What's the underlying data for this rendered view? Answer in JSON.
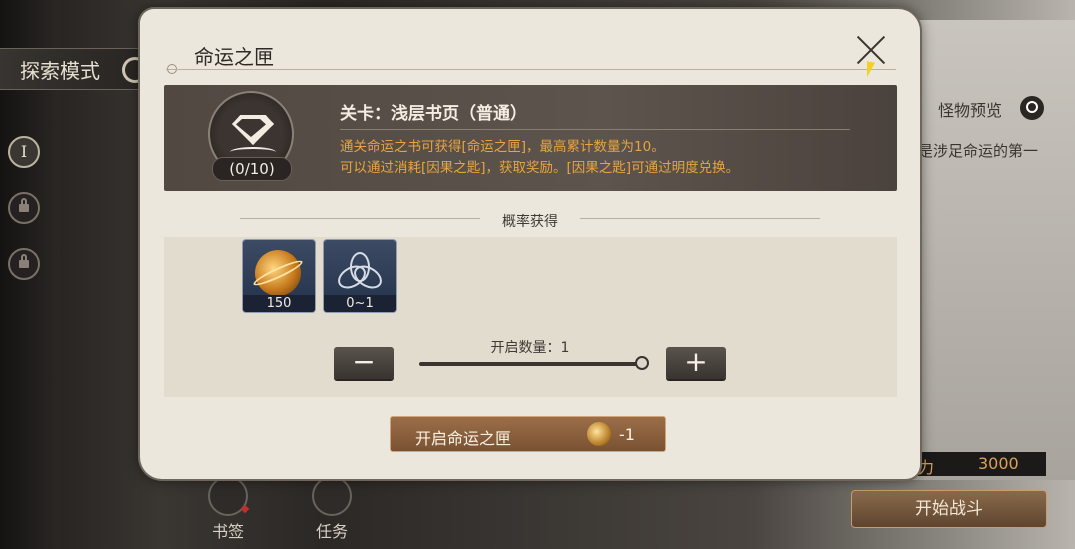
{
  "background": {
    "explore_mode_label": "探索模式",
    "stage_nodes": [
      {
        "label": "I",
        "locked": false
      },
      {
        "label": "",
        "locked": true
      },
      {
        "label": "",
        "locked": true
      }
    ],
    "monster_preview_label": "怪物预览",
    "side_description": "是涉足命运的第一",
    "power_label": "力",
    "power_value": "3000",
    "start_battle_label": "开始战斗",
    "bottom_buttons": [
      {
        "label": "书签",
        "has_alert": true
      },
      {
        "label": "任务",
        "has_alert": false
      }
    ]
  },
  "dialog": {
    "title": "命运之匣",
    "stage": {
      "name": "关卡：浅层书页（普通）",
      "count": "(0/10)",
      "description_lines": [
        "通关命运之书可获得[命运之匣]，最高累计数量为10。",
        "可以通过消耗[因果之匙]，获取奖励。[因果之匙]可通过明度兑换。"
      ]
    },
    "drops_title": "概率获得",
    "items": [
      {
        "icon": "gold-orb-icon",
        "quantity": "150"
      },
      {
        "icon": "triquetra-icon",
        "quantity": "0~1"
      }
    ],
    "open_count_label": "开启数量：1",
    "open_count": {
      "value": 1,
      "min": 1,
      "max": 1
    },
    "decrement_label": "−",
    "increment_label": "+",
    "open_button_label": "开启命运之匣",
    "open_cost": "-1"
  },
  "colors": {
    "panel": "#ece7dc",
    "banner": "#544b45",
    "accent_text": "#e8a53e",
    "button": "#8a603e"
  }
}
